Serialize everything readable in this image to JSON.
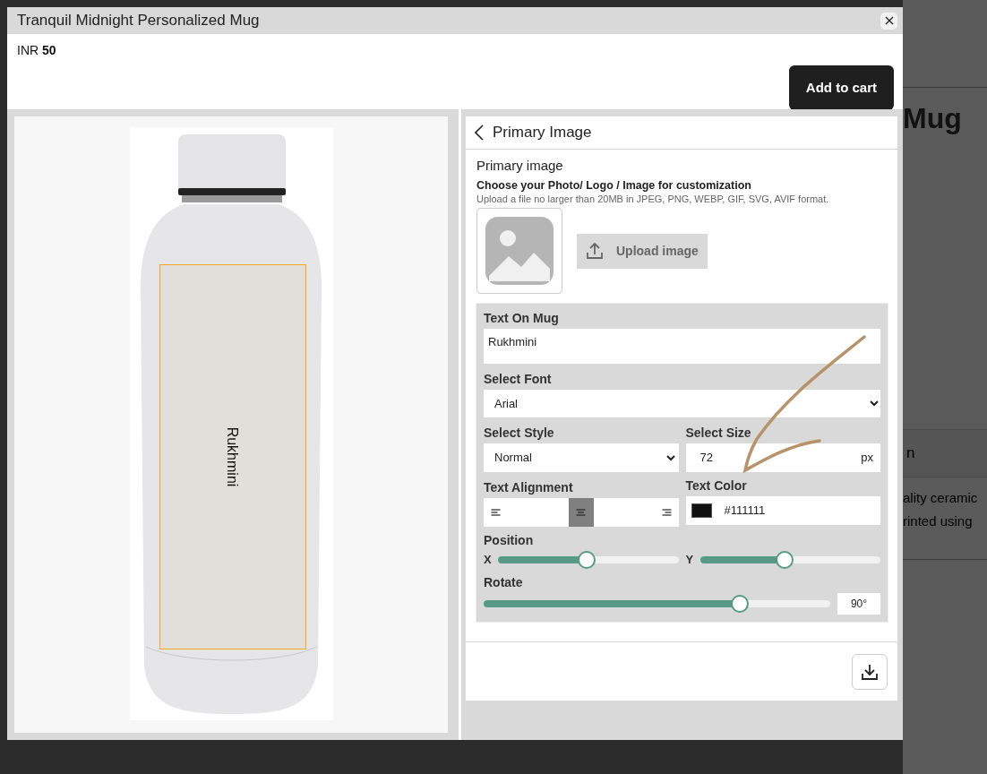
{
  "background_page": {
    "heading": "Mug",
    "section_label": "n",
    "description_lines": [
      "ality ceramic",
      "rinted using"
    ]
  },
  "modal": {
    "title": "Tranquil Midnight Personalized Mug",
    "price": "INR **50**",
    "add_to_cart": "Add to cart",
    "preview": {
      "print_text": "Rukhmini"
    },
    "panel": {
      "title": "Primary Image",
      "section_title": "Primary image",
      "instruction": "Choose your Photo/ Logo / Image for customization",
      "hint": "Upload a file no larger than 20MB in JPEG, PNG, WEBP, GIF, SVG, AVIF format.",
      "upload_button": "Upload image",
      "text_on_mug": {
        "label": "Text On Mug",
        "value": "Rukhmini"
      },
      "font": {
        "label": "Select Font",
        "value": "Arial"
      },
      "style": {
        "label": "Select Style",
        "value": "Normal"
      },
      "size": {
        "label": "Select Size",
        "value": "72",
        "unit": "px"
      },
      "alignment": {
        "label": "Text Alignment",
        "options": [
          {
            "kind": "left",
            "selected": false
          },
          {
            "kind": "center",
            "selected": true
          },
          {
            "kind": "right",
            "selected": false
          }
        ]
      },
      "text_color": {
        "label": "Text Color",
        "value": "#111111",
        "color": "#111111"
      },
      "position": {
        "label": "Position",
        "sliders": [
          {
            "axis": "X",
            "level": 0.49
          },
          {
            "axis": "Y",
            "level": 0.47
          }
        ]
      },
      "rotate": {
        "label": "Rotate",
        "level": 0.74,
        "reading": "90°"
      }
    }
  }
}
